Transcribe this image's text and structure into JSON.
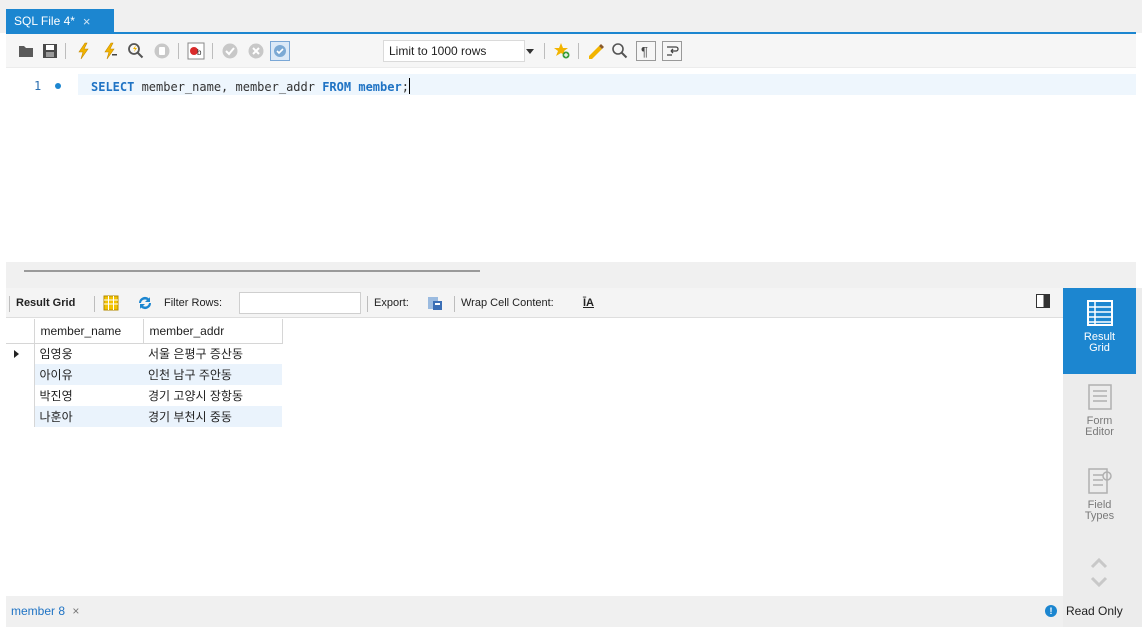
{
  "tab": {
    "title": "SQL File 4*",
    "close": "×"
  },
  "toolbar": {
    "icons": [
      "open-folder-icon",
      "save-icon",
      "execute-icon",
      "execute-current-icon",
      "explain-icon",
      "stop-icon",
      "toggle-error-icon",
      "commit-icon",
      "rollback-icon",
      "autocommit-icon",
      "bookmark-icon",
      "beautify-icon",
      "find-icon",
      "invisible-chars-icon",
      "word-wrap-icon"
    ],
    "limit_label": "Limit to 1000 rows"
  },
  "editor": {
    "line_number": "1",
    "code": {
      "kw1": "SELECT",
      "part1": " member_name, member_addr ",
      "kw2": "FROM",
      "part2": " ",
      "kw3": "member",
      "part3": ";"
    }
  },
  "result_toolbar": {
    "result_grid_label": "Result Grid",
    "filter_label": "Filter Rows:",
    "filter_value": "",
    "export_label": "Export:",
    "wrap_label": "Wrap Cell Content:",
    "wrap_icon_glyph": "ĪA"
  },
  "grid": {
    "columns": [
      "member_name",
      "member_addr"
    ],
    "rows": [
      [
        "임영웅",
        "서울 은평구 증산동"
      ],
      [
        "아이유",
        "인천 남구 주안동"
      ],
      [
        "박진영",
        "경기 고양시 장항동"
      ],
      [
        "나훈아",
        "경기 부천시 중동"
      ]
    ]
  },
  "right_panel": {
    "result_grid": "Result Grid",
    "form_editor": "Form Editor",
    "field_types": "Field Types"
  },
  "bottom": {
    "result_tab": "member 8",
    "result_tab_close": "×",
    "read_only": "Read Only",
    "info_glyph": "!"
  },
  "colors": {
    "accent": "#1c86d0",
    "keyword": "#1f73c4",
    "row_alt": "#eaf3fc"
  }
}
